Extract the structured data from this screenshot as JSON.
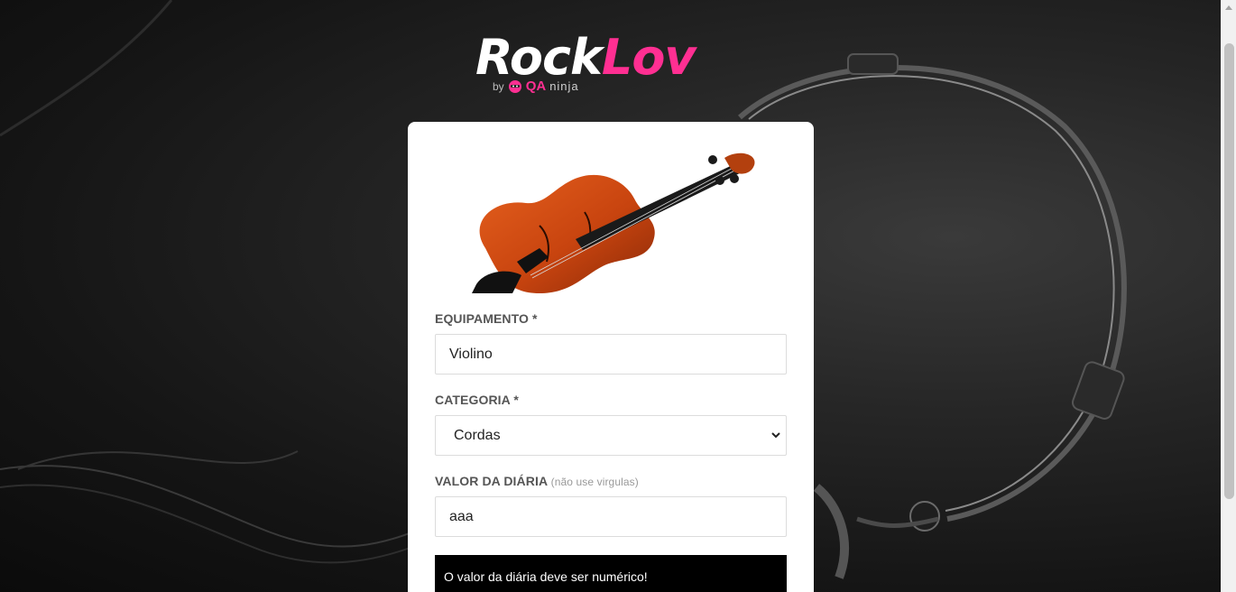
{
  "brand": {
    "part1": "Rock",
    "part2": "Lov",
    "by": "by",
    "qa": "QA",
    "ninja": "ninja"
  },
  "form": {
    "equipment_label": "EQUIPAMENTO *",
    "equipment_value": "Violino",
    "category_label": "CATEGORIA *",
    "category_value": "Cordas",
    "price_label": "VALOR DA DIÁRIA",
    "price_hint": "(não use virgulas)",
    "price_value": "aaa",
    "error_message": "O valor da diária deve ser numérico!"
  },
  "colors": {
    "accent": "#ff2f92",
    "alert_bg": "#000000"
  },
  "icons": {
    "select": "chevron-down-icon",
    "thumbnail": "violin-image"
  }
}
